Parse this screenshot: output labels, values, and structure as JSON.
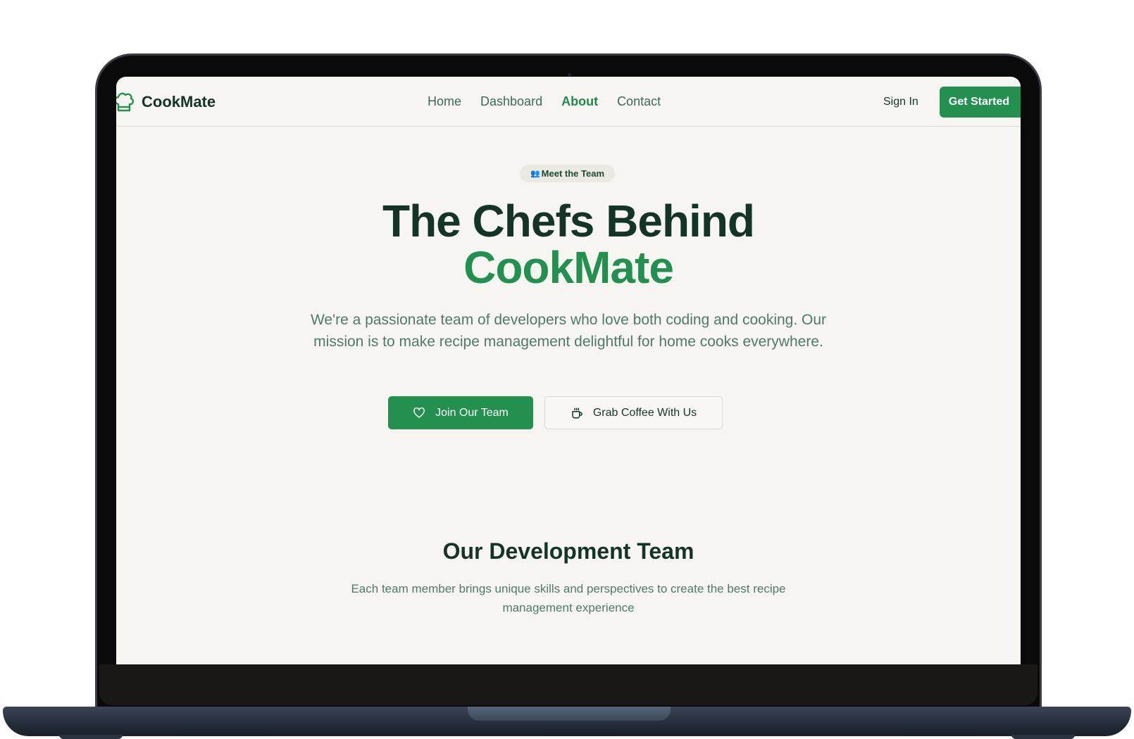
{
  "brand": {
    "name": "CookMate",
    "icon": "chef-hat-icon"
  },
  "nav": {
    "links": [
      {
        "label": "Home",
        "active": false
      },
      {
        "label": "Dashboard",
        "active": false
      },
      {
        "label": "About",
        "active": true
      },
      {
        "label": "Contact",
        "active": false
      }
    ],
    "sign_in": "Sign In",
    "get_started": "Get Started"
  },
  "hero": {
    "badge_icon": "👥",
    "badge_label": "Meet the Team",
    "headline_line1": "The Chefs Behind",
    "headline_line2": "CookMate",
    "lead": "We're a passionate team of developers who love both coding and cooking. Our mission is to make recipe management delightful for home cooks everywhere.",
    "primary_button": {
      "label": "Join Our Team",
      "icon": "heart-icon"
    },
    "secondary_button": {
      "label": "Grab Coffee With Us",
      "icon": "coffee-icon"
    }
  },
  "team": {
    "title": "Our Development Team",
    "subtitle": "Each team member brings unique skills and perspectives to create the best recipe management experience"
  },
  "colors": {
    "brand_green": "#23904f",
    "dark_green": "#143526",
    "muted_green": "#4f7a67",
    "page_bg": "#f6f5f1"
  }
}
